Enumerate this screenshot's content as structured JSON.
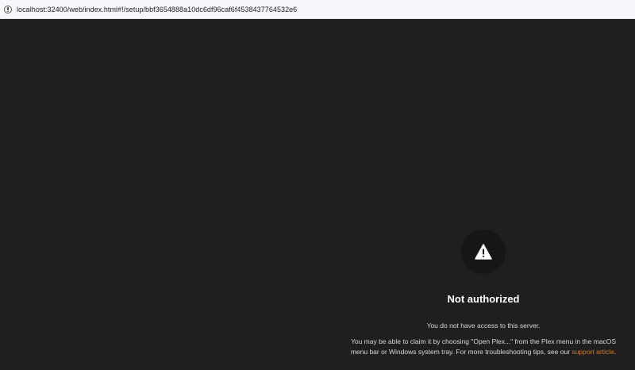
{
  "browser": {
    "url": "localhost:32400/web/index.html#!/setup/bbf3654888a10dc6df96caf6f4538437764532e6",
    "site_info_icon": "info-icon"
  },
  "error": {
    "icon": "warning-triangle-icon",
    "title": "Not authorized",
    "access_message": "You do not have access to this server.",
    "claim_message_before": "You may be able to claim it by choosing \"Open Plex...\" from the Plex menu in the macOS menu bar or Windows system tray. For more troubleshooting tips, see our ",
    "support_link": "support article",
    "claim_message_after": "."
  },
  "colors": {
    "background": "#1f1f1f",
    "link": "#cc7b19"
  }
}
